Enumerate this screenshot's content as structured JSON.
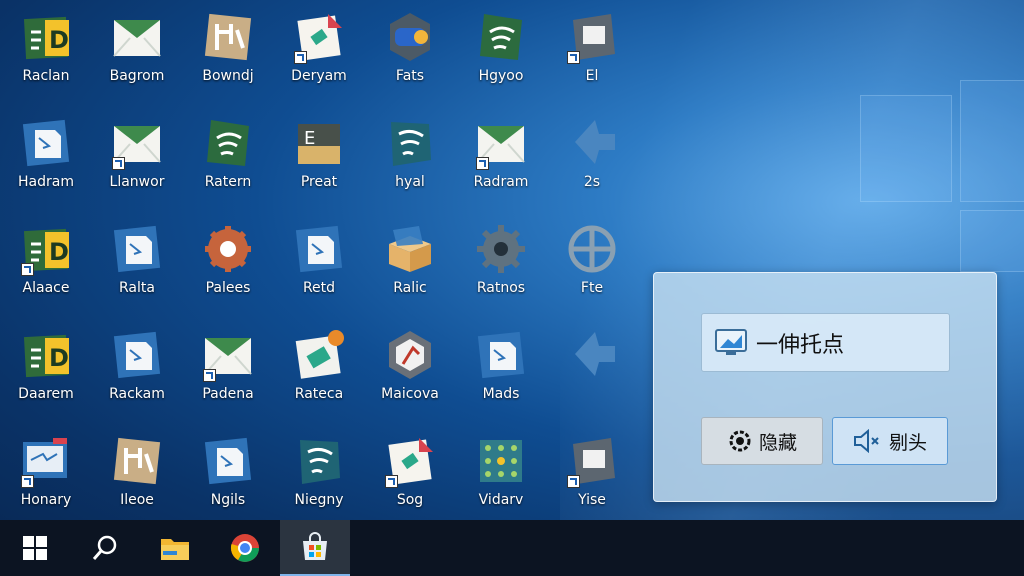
{
  "desktop": {
    "icons": [
      {
        "label": "Raclan",
        "icon": "document-green-yellow-icon"
      },
      {
        "label": "Bagrom",
        "icon": "envelope-icon"
      },
      {
        "label": "Bowndj",
        "icon": "tan-tool-icon"
      },
      {
        "label": "Deryam",
        "icon": "paper-red-corner-icon"
      },
      {
        "label": "Fats",
        "icon": "gray-puzzle-icon"
      },
      {
        "label": "Hgyoo",
        "icon": "green-wifi-icon"
      },
      {
        "label": "El",
        "icon": "gray-square-icon"
      },
      {
        "label": "Hadram",
        "icon": "blue-paper-icon"
      },
      {
        "label": "Llanwor",
        "icon": "envelope-icon"
      },
      {
        "label": "Ratern",
        "icon": "green-wifi-icon"
      },
      {
        "label": "Preat",
        "icon": "tan-box-icon"
      },
      {
        "label": "hyal",
        "icon": "teal-wifi-icon"
      },
      {
        "label": "Radram",
        "icon": "envelope-icon"
      },
      {
        "label": "2s",
        "icon": "blue-arrow-icon"
      },
      {
        "label": "Alaace",
        "icon": "document-green-yellow-icon"
      },
      {
        "label": "Ralta",
        "icon": "blue-paper-icon"
      },
      {
        "label": "Palees",
        "icon": "orange-gear-icon"
      },
      {
        "label": "Retd",
        "icon": "blue-paper-icon"
      },
      {
        "label": "Ralic",
        "icon": "open-box-icon"
      },
      {
        "label": "Ratnos",
        "icon": "gray-gear-icon"
      },
      {
        "label": "Fte",
        "icon": "crosshair-icon"
      },
      {
        "label": "Daarem",
        "icon": "document-green-yellow-icon"
      },
      {
        "label": "Rackam",
        "icon": "blue-paper-icon"
      },
      {
        "label": "Padena",
        "icon": "envelope-icon"
      },
      {
        "label": "Rateca",
        "icon": "paper-orange-badge-icon"
      },
      {
        "label": "Maicova",
        "icon": "hexagon-icon"
      },
      {
        "label": "Mads",
        "icon": "blue-paper-icon"
      },
      {
        "label": "",
        "icon": "blue-arrow-icon"
      },
      {
        "label": "Honary",
        "icon": "blue-monitor-icon"
      },
      {
        "label": "Ileoe",
        "icon": "tan-tool-icon"
      },
      {
        "label": "Ngils",
        "icon": "blue-paper-icon"
      },
      {
        "label": "Niegny",
        "icon": "teal-wifi-icon"
      },
      {
        "label": "Sog",
        "icon": "paper-red-corner-icon"
      },
      {
        "label": "Vidarv",
        "icon": "dotted-grid-icon"
      },
      {
        "label": "Yise",
        "icon": "gray-square-icon"
      }
    ]
  },
  "panel": {
    "field_text": "一伸托点",
    "hide_label": "隐藏",
    "mute_label": "剔头"
  },
  "taskbar": {
    "items": [
      "start-icon",
      "search-icon",
      "folder-icon",
      "chrome-icon",
      "store-icon"
    ]
  },
  "colors": {
    "desktop_bg": "#0f4d92",
    "taskbar_bg": "#0c1422",
    "panel_bg": "#c4def0",
    "mute_border": "#5a9ad6"
  }
}
